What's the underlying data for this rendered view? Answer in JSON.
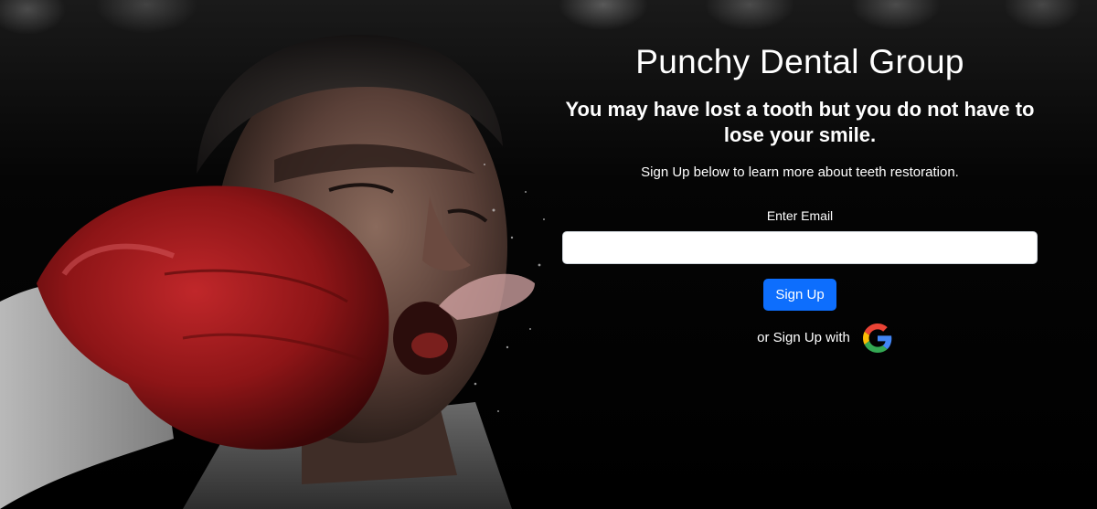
{
  "page": {
    "title": "Punchy Dental Group",
    "tagline": "You may have lost a tooth but you do not have to lose your smile.",
    "subtext": "Sign Up below to learn more about teeth restoration."
  },
  "form": {
    "email_label": "Enter Email",
    "email_value": "",
    "email_placeholder": "",
    "signup_label": "Sign Up",
    "alt_signup_text": "or Sign Up with"
  },
  "icons": {
    "social": "google-icon"
  },
  "colors": {
    "primary_button": "#0d6efd",
    "background": "#000000",
    "text": "#ffffff"
  }
}
